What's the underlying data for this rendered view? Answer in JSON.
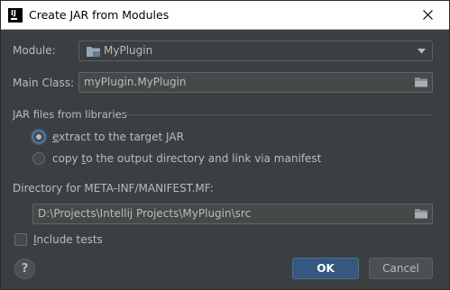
{
  "window": {
    "title": "Create JAR from Modules"
  },
  "module": {
    "label": "Module:",
    "value": "MyPlugin"
  },
  "main_class": {
    "label": "Main Class:",
    "value": "myPlugin.MyPlugin"
  },
  "jar_files": {
    "section_title": "JAR files from libraries",
    "options": [
      {
        "label_pre": "",
        "label_u": "e",
        "label_post": "xtract to the target JAR",
        "selected": true
      },
      {
        "label_pre": "copy ",
        "label_u": "t",
        "label_post": "o the output directory and link via manifest",
        "selected": false
      }
    ]
  },
  "manifest": {
    "label": "Directory for META-INF/MANIFEST.MF:",
    "value": "D:\\Projects\\Intellij Projects\\MyPlugin\\src"
  },
  "include_tests": {
    "label_u": "I",
    "label_rest": "nclude tests",
    "checked": false
  },
  "buttons": {
    "help": "?",
    "ok": "OK",
    "cancel": "Cancel"
  },
  "colors": {
    "background": "#3c3f41",
    "text": "#bbbbbb",
    "accent": "#365880"
  }
}
